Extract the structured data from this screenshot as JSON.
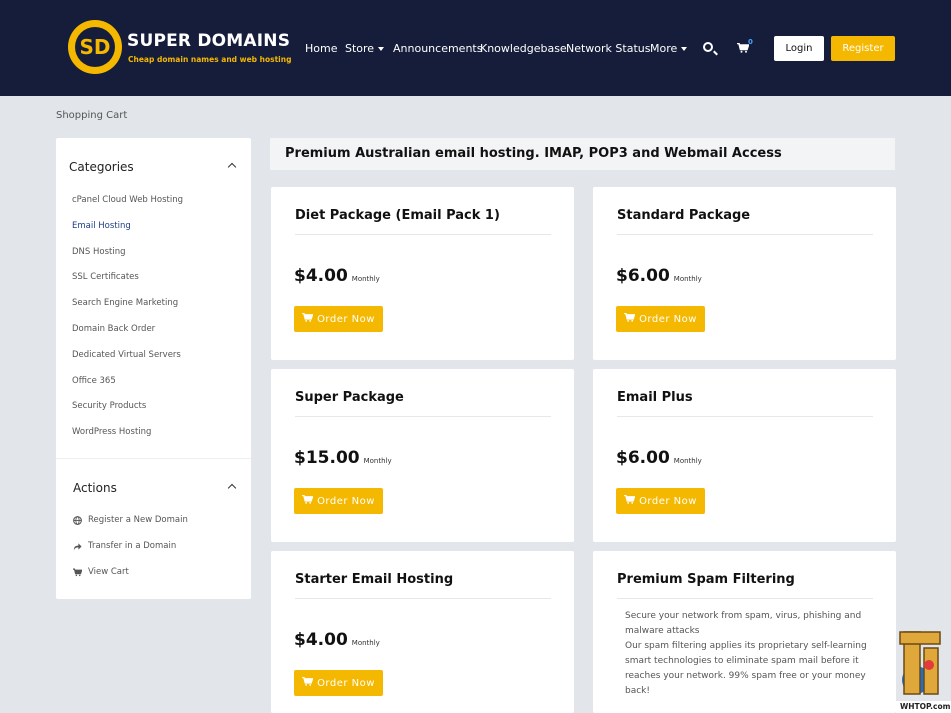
{
  "header": {
    "logo_letters": "SD",
    "logo_title": "SUPER DOMAINS",
    "logo_tagline": "Cheap domain names and web hosting",
    "nav": [
      "Home",
      "Store",
      "Announcements",
      "Knowledgebase",
      "Network Status",
      "More"
    ],
    "cart_count": "0",
    "login_label": "Login",
    "register_label": "Register",
    "accent_color": "#f5b800",
    "bg_color": "#151d3b"
  },
  "breadcrumb": "Shopping Cart",
  "sidebar": {
    "categories_title": "Categories",
    "categories": [
      "cPanel Cloud Web Hosting",
      "Email Hosting",
      "DNS Hosting",
      "SSL Certificates",
      "Search Engine Marketing",
      "Domain Back Order",
      "Dedicated Virtual Servers",
      "Office 365",
      "Security Products",
      "WordPress Hosting"
    ],
    "active_category": "Email Hosting",
    "actions_title": "Actions",
    "actions": [
      {
        "label": "Register a New Domain",
        "icon": "globe-icon"
      },
      {
        "label": "Transfer in a Domain",
        "icon": "share-icon"
      },
      {
        "label": "View Cart",
        "icon": "cart-icon"
      }
    ]
  },
  "main": {
    "heading": "Premium Australian email hosting. IMAP, POP3 and Webmail Access",
    "order_label": "Order Now",
    "products": [
      {
        "name": "Diet Package (Email Pack 1)",
        "price": "$4.00",
        "period": "Monthly"
      },
      {
        "name": "Standard Package",
        "price": "$6.00",
        "period": "Monthly"
      },
      {
        "name": "Super Package",
        "price": "$15.00",
        "period": "Monthly"
      },
      {
        "name": "Email Plus",
        "price": "$6.00",
        "period": "Monthly"
      },
      {
        "name": "Starter Email Hosting",
        "price": "$4.00",
        "period": "Monthly"
      },
      {
        "name": "Premium Spam Filtering",
        "description": [
          "Secure your network from spam, virus, phishing and malware attacks",
          "Our spam filtering applies its proprietary self-learning smart technologies to eliminate spam mail before it reaches your network. 99% spam free or your money back!"
        ]
      }
    ]
  },
  "watermark": "WHTOP.com"
}
